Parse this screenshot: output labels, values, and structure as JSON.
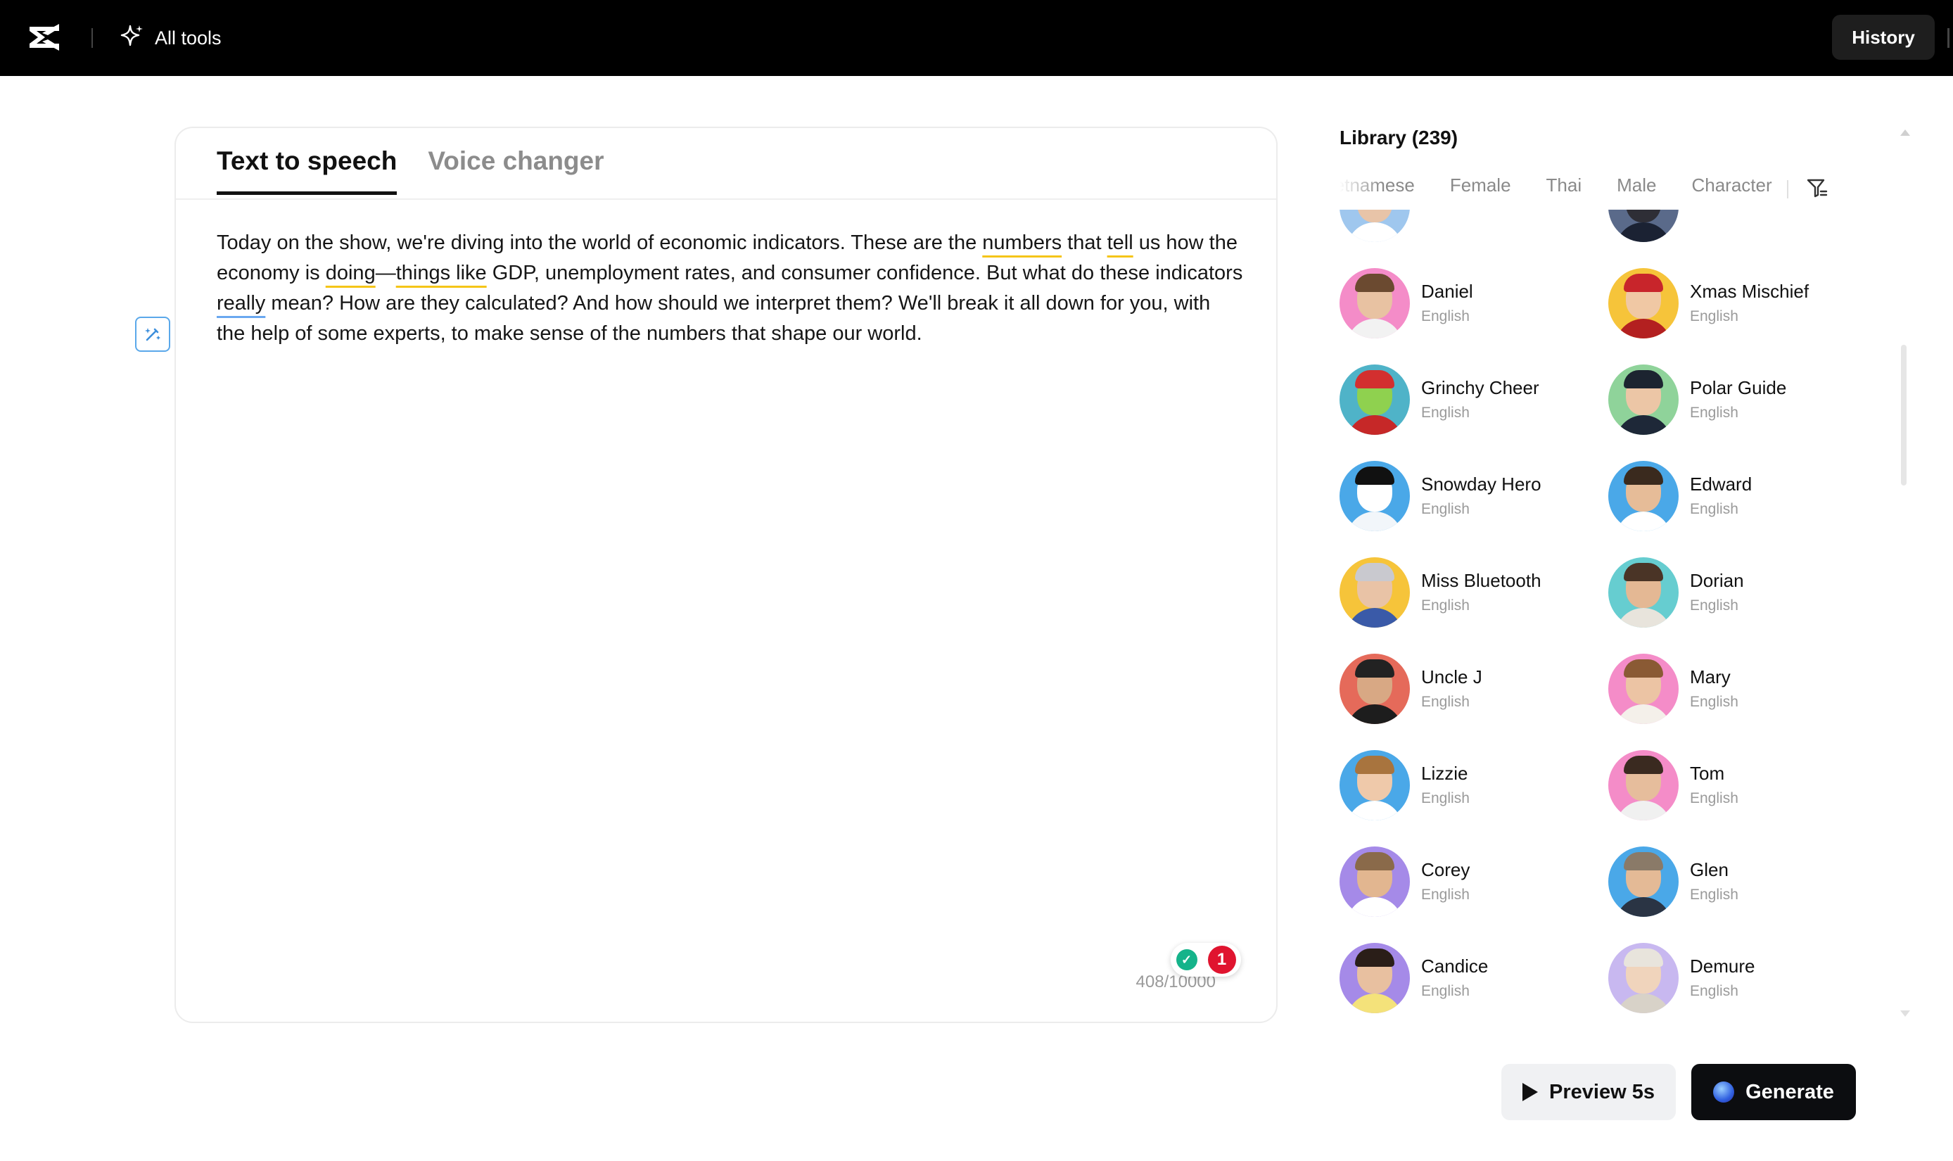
{
  "topbar": {
    "all_tools_label": "All tools",
    "history_label": "History"
  },
  "editor": {
    "tabs": [
      {
        "label": "Text to speech",
        "active": true
      },
      {
        "label": "Voice changer",
        "active": false
      }
    ],
    "script_segments": [
      {
        "text": "Today on the show, we're diving into the world of economic indicators. These are the ",
        "mark": "none"
      },
      {
        "text": "numbers",
        "mark": "warn"
      },
      {
        "text": " that ",
        "mark": "none"
      },
      {
        "text": "tell",
        "mark": "warn"
      },
      {
        "text": " us how the economy is ",
        "mark": "none"
      },
      {
        "text": "doing",
        "mark": "warn"
      },
      {
        "text": "—",
        "mark": "none"
      },
      {
        "text": "things like",
        "mark": "warn"
      },
      {
        "text": " GDP, unemployment rates, and consumer confidence. But what do these indicators ",
        "mark": "none"
      },
      {
        "text": "really",
        "mark": "info"
      },
      {
        "text": " mean? How are they calculated? And how should we interpret them? We'll break it all down for you, with the help of some experts, to make sense of the numbers that shape our world.",
        "mark": "none"
      }
    ],
    "char_count": "408/10000",
    "assistant_badge": "1"
  },
  "library": {
    "title": "Library (239)",
    "filters": [
      "Vietnamese",
      "Female",
      "Thai",
      "Male",
      "Character"
    ],
    "voices": [
      {
        "name": "",
        "lang": "",
        "skin": "#e8c4a8",
        "hair": "#caa070",
        "bg": "#9fc7ee",
        "body": "#ffffff"
      },
      {
        "name": "",
        "lang": "",
        "skin": "#2e2e36",
        "hair": "#1a1a22",
        "bg": "#5a6a8a",
        "body": "#1b2233"
      },
      {
        "name": "Daniel",
        "lang": "English",
        "skin": "#e8c2a2",
        "hair": "#6b4a30",
        "bg": "#f48cc8",
        "body": "#f2f2f2"
      },
      {
        "name": "Xmas Mischief",
        "lang": "English",
        "skin": "#f0c8a4",
        "hair": "#c8252b",
        "bg": "#f6c43a",
        "body": "#b32020"
      },
      {
        "name": "Grinchy Cheer",
        "lang": "English",
        "skin": "#8fd14f",
        "hair": "#d32f2f",
        "bg": "#4fb3c8",
        "body": "#c62828"
      },
      {
        "name": "Polar Guide",
        "lang": "English",
        "skin": "#ecc6a6",
        "hair": "#1c2430",
        "bg": "#8fd39a",
        "body": "#1e2838"
      },
      {
        "name": "Snowday Hero",
        "lang": "English",
        "skin": "#ffffff",
        "hair": "#111111",
        "bg": "#4aa8e8",
        "body": "#f2f6fa"
      },
      {
        "name": "Edward",
        "lang": "English",
        "skin": "#e6bc98",
        "hair": "#3a2a1e",
        "bg": "#4aa8e8",
        "body": "#ffffff"
      },
      {
        "name": "Miss Bluetooth",
        "lang": "English",
        "skin": "#e9c3a6",
        "hair": "#c9c9cf",
        "bg": "#f6c43a",
        "body": "#3a5aa8"
      },
      {
        "name": "Dorian",
        "lang": "English",
        "skin": "#e4b894",
        "hair": "#4a3426",
        "bg": "#66cdd0",
        "body": "#e8e4dc"
      },
      {
        "name": "Uncle J",
        "lang": "English",
        "skin": "#d8a884",
        "hair": "#222222",
        "bg": "#e56a5a",
        "body": "#1d1d1d"
      },
      {
        "name": "Mary",
        "lang": "English",
        "skin": "#ecc4a4",
        "hair": "#8a5a34",
        "bg": "#f48cc8",
        "body": "#f4f0ea"
      },
      {
        "name": "Lizzie",
        "lang": "English",
        "skin": "#efc9aa",
        "hair": "#a8743e",
        "bg": "#4aa8e8",
        "body": "#ffffff"
      },
      {
        "name": "Tom",
        "lang": "English",
        "skin": "#e6bd9c",
        "hair": "#3a2a20",
        "bg": "#f48cc8",
        "body": "#f0f0f0"
      },
      {
        "name": "Corey",
        "lang": "English",
        "skin": "#e2b690",
        "hair": "#8a6a4a",
        "bg": "#a58ae8",
        "body": "#ffffff"
      },
      {
        "name": "Glen",
        "lang": "English",
        "skin": "#e4ba96",
        "hair": "#8a7a68",
        "bg": "#4aa8e8",
        "body": "#2a3444"
      },
      {
        "name": "Candice",
        "lang": "English",
        "skin": "#e8c0a0",
        "hair": "#2a1e18",
        "bg": "#a58ae8",
        "body": "#f4e27a"
      },
      {
        "name": "Demure",
        "lang": "English",
        "skin": "#f0d4bc",
        "hair": "#e8e4dc",
        "bg": "#c8b8f0",
        "body": "#d8d2c8"
      }
    ]
  },
  "actions": {
    "preview_label": "Preview 5s",
    "generate_label": "Generate"
  }
}
